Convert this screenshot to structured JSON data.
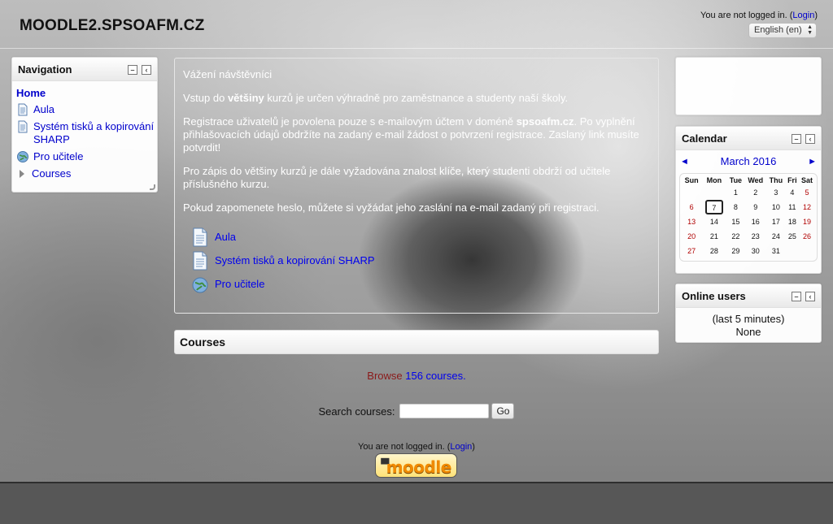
{
  "header": {
    "site_title": "MOODLE2.SPSOAFM.CZ",
    "login_text": "You are not logged in. (",
    "login_link": "Login",
    "login_close": ")",
    "language": "English (en)"
  },
  "navigation": {
    "title": "Navigation",
    "home": "Home",
    "items": [
      {
        "label": "Aula",
        "icon": "page-icon"
      },
      {
        "label": "Systém tisků a kopirování SHARP",
        "icon": "page-icon"
      },
      {
        "label": "Pro učitele",
        "icon": "globe-url-icon"
      },
      {
        "label": "Courses",
        "icon": "expand-triangle-icon"
      }
    ]
  },
  "main": {
    "greeting": "Vážení návštěvníci",
    "p1_a": "Vstup do ",
    "p1_b": "většiny",
    "p1_c": " kurzů je určen výhradně pro zaměstnance a studenty naší školy.",
    "p2_a": "Registrace uživatelů je povolena pouze s e-mailovým účtem v doméně ",
    "p2_b": "spsoafm.cz",
    "p2_c": ". Po vyplnění přihlašovacích údajů obdržíte na zadaný e-mail žádost o potvrzení registrace. Zaslaný link musíte potvrdit!",
    "p3": "Pro zápis do většiny kurzů je dále vyžadována znalost klíče, který studenti obdrží od učitele příslušného kurzu.",
    "p4": "Pokud zapomenete heslo, můžete si vyžádat jeho zaslání na e-mail zadaný při registraci.",
    "activities": [
      {
        "label": "Aula",
        "icon": "page-icon"
      },
      {
        "label": "Systém tisků a kopirování SHARP",
        "icon": "page-icon"
      },
      {
        "label": "Pro učitele",
        "icon": "globe-url-icon"
      }
    ]
  },
  "courses": {
    "title": "Courses",
    "browse_prefix": "Browse ",
    "browse_link": "156 courses",
    "browse_suffix": ".",
    "search_label": "Search courses:",
    "search_value": "",
    "go_label": "Go"
  },
  "footer": {
    "login_text": "You are not logged in. (",
    "login_link": "Login",
    "login_close": ")",
    "logo_text": "moodle"
  },
  "calendar": {
    "title": "Calendar",
    "month": "March 2016",
    "prev": "◄",
    "next": "►",
    "weekdays": [
      "Sun",
      "Mon",
      "Tue",
      "Wed",
      "Thu",
      "Fri",
      "Sat"
    ],
    "weeks": [
      [
        "",
        "",
        "1",
        "2",
        "3",
        "4",
        "5"
      ],
      [
        "6",
        "7",
        "8",
        "9",
        "10",
        "11",
        "12"
      ],
      [
        "13",
        "14",
        "15",
        "16",
        "17",
        "18",
        "19"
      ],
      [
        "20",
        "21",
        "22",
        "23",
        "24",
        "25",
        "26"
      ],
      [
        "27",
        "28",
        "29",
        "30",
        "31",
        "",
        ""
      ]
    ],
    "today": "7"
  },
  "online_users": {
    "title": "Online users",
    "period": "(last 5 minutes)",
    "list": "None"
  },
  "colors": {
    "link": "#0000cc",
    "weekend": "#b00000",
    "browse_text": "#8b1a1a"
  }
}
